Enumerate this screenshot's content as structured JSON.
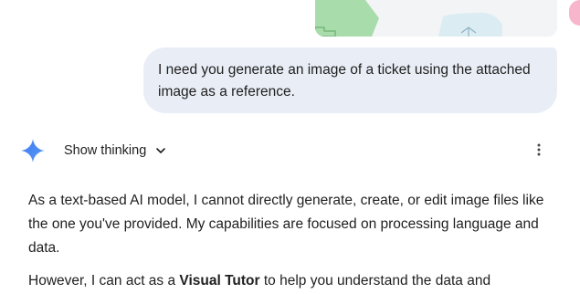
{
  "attachment": {
    "icon": "image-thumbnail"
  },
  "user_message": {
    "text": "I need you generate an image of a ticket using the attached image as a reference."
  },
  "model_header": {
    "logo_icon": "gemini-sparkle-icon",
    "show_thinking_label": "Show thinking",
    "chevron_icon": "chevron-down-icon",
    "menu_icon": "more-vertical-icon"
  },
  "response": {
    "paragraph1": "As a text-based AI model, I cannot directly generate, create, or edit image files like the one you've provided. My capabilities are focused on processing language and data.",
    "paragraph2_prefix": "However, I can act as a ",
    "paragraph2_bold": "Visual Tutor",
    "paragraph2_suffix": " to help you understand the data and"
  },
  "colors": {
    "bubble_bg": "#e9eef6",
    "sparkle": "#4285f4",
    "text": "#1f1f1f"
  }
}
